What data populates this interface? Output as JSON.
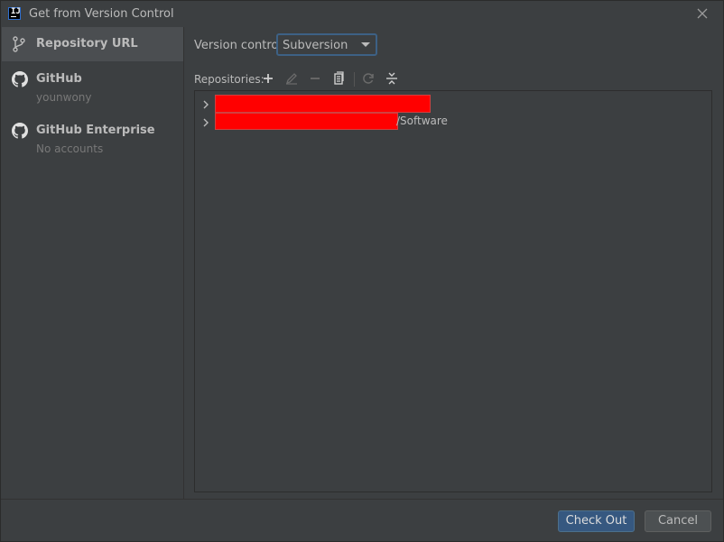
{
  "window": {
    "title": "Get from Version Control",
    "app_icon": "intellij-icon",
    "close_icon": "close-icon"
  },
  "sidebar": {
    "items": [
      {
        "label": "Repository URL",
        "sub": "",
        "icon": "vcs-branch-icon",
        "selected": true
      },
      {
        "label": "GitHub",
        "sub": "younwony",
        "icon": "github-icon",
        "selected": false
      },
      {
        "label": "GitHub Enterprise",
        "sub": "No accounts",
        "icon": "github-icon",
        "selected": false
      }
    ]
  },
  "version_control": {
    "label": "Version control:",
    "selected": "Subversion"
  },
  "repositories": {
    "label": "Repositories:",
    "toolbar": [
      "add-icon",
      "edit-icon",
      "remove-icon",
      "copy-icon",
      "refresh-icon",
      "collapse-all-icon"
    ],
    "rows": [
      {
        "suffix": "",
        "redacted": true
      },
      {
        "suffix": "/Software",
        "redacted": true
      }
    ],
    "redaction_color": "#ff0000"
  },
  "buttons": {
    "primary": "Check Out",
    "secondary": "Cancel"
  },
  "colors": {
    "background": "#3c3f41",
    "selection": "#4b4e51",
    "accent": "#365880",
    "focus_border": "#3d6185"
  }
}
